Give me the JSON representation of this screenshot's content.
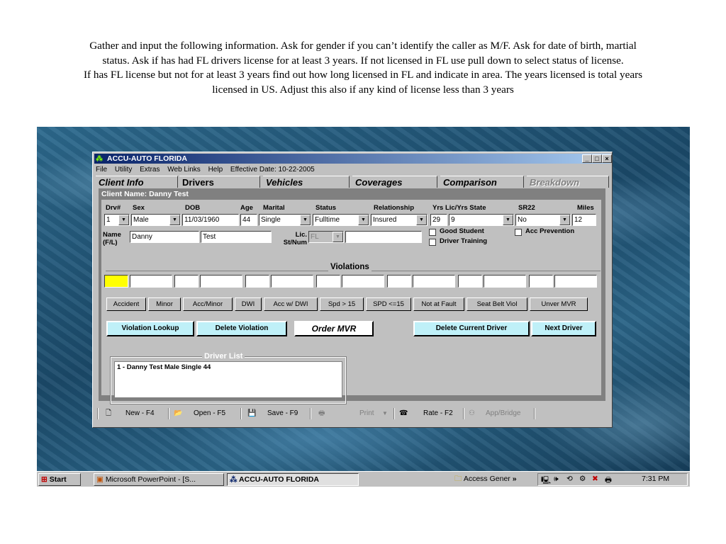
{
  "slide": {
    "lines": [
      "Gather and input the following information. Ask for gender if you can’t identify the caller as M/F. Ask for date of birth, martial",
      "status. Ask if has had FL drivers license for at least 3 years. If not licensed in FL use pull down to select status of license.",
      "If has FL license but not for at least 3 years find out how long licensed in FL and indicate in area. The years licensed is total  years",
      "licensed in US. Adjust this also if any kind of license less than 3 years"
    ]
  },
  "window": {
    "title": "ACCU-AUTO FLORIDA",
    "controls": [
      "_",
      "□",
      "×"
    ],
    "menu": [
      "File",
      "Utility",
      "Extras",
      "Web Links",
      "Help",
      "Effective Date: 10-22-2005"
    ],
    "tabs": [
      {
        "label": "Client Info"
      },
      {
        "label": "Drivers"
      },
      {
        "label": "Vehicles"
      },
      {
        "label": "Coverages"
      },
      {
        "label": "Comparison"
      },
      {
        "label": "Breakdown"
      }
    ]
  },
  "client_name": "Client Name: Danny Test",
  "headers": {
    "drv": "Drv#",
    "sex": "Sex",
    "dob": "DOB",
    "age": "Age",
    "marital": "Marital",
    "status": "Status",
    "relationship": "Relationship",
    "yrs_lic": "Yrs Lic/Yrs State",
    "sr22": "SR22",
    "miles": "Miles"
  },
  "fields": {
    "drv": "1",
    "sex": "Male",
    "dob": "11/03/1960",
    "age": "44",
    "marital": "Single",
    "status": "Fulltime",
    "relationship": "Insured",
    "yrs_lic": "29",
    "yrs_state": "9",
    "sr22": "No",
    "miles": "12",
    "name_label": "Name (F/L)",
    "first_name": "Danny",
    "last_name": "Test",
    "lic_label": "Lic. St/Num",
    "lic_state": "FL",
    "lic_num": ""
  },
  "checkboxes": {
    "good_student": "Good Student",
    "driver_training": "Driver Training",
    "acc_prevention": "Acc Prevention"
  },
  "violations_title": "Violations",
  "violation_buttons": [
    "Accident",
    "Minor",
    "Acc/Minor",
    "DWI",
    "Acc w/ DWI",
    "Spd > 15",
    "SPD <=15",
    "Not at Fault",
    "Seat Belt Viol",
    "Unver MVR"
  ],
  "actions": {
    "lookup": "Violation Lookup",
    "delete_violation": "Delete Violation",
    "order_mvr": "Order MVR",
    "delete_driver": "Delete Current Driver",
    "next_driver": "Next Driver"
  },
  "driver_list": {
    "title": "Driver List",
    "items": [
      "1 - Danny Test Male Single 44"
    ]
  },
  "toolbar": {
    "new": "New - F4",
    "open": "Open - F5",
    "save": "Save - F9",
    "print": "Print",
    "rate": "Rate - F2",
    "app": "App/Bridge"
  },
  "taskbar": {
    "start": "Start",
    "task1": "Microsoft PowerPoint - [S...",
    "task2": "ACCU-AUTO FLORIDA",
    "access": "Access Gener",
    "more": "»",
    "clock": "7:31 PM"
  },
  "colors": {
    "titlebar_start": "#0a246a",
    "titlebar_end": "#a6caf0",
    "cyan_button": "#bff0f8",
    "highlight_cell": "#ffff00"
  }
}
